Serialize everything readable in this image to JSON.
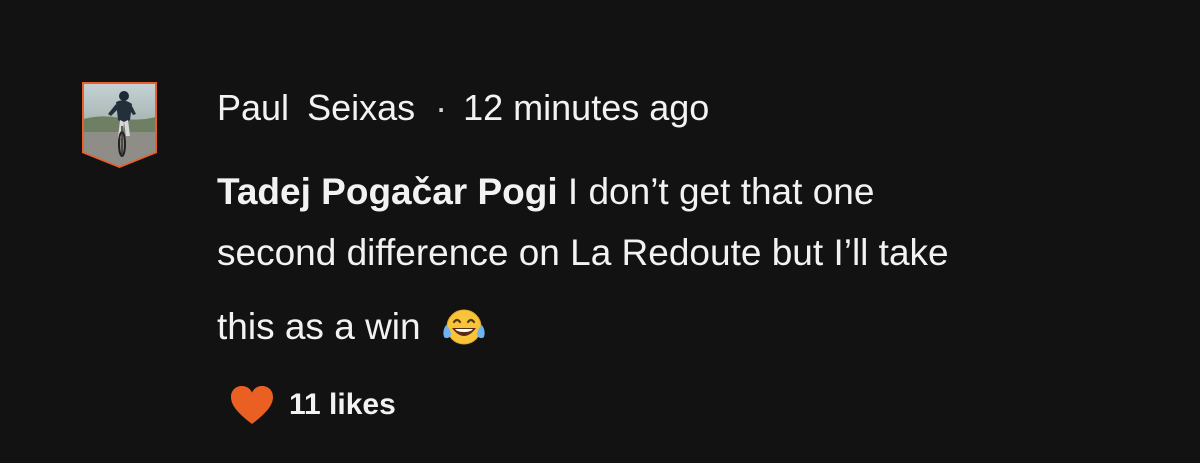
{
  "comment": {
    "author_first": "Paul",
    "author_last": "Seixas",
    "separator": "·",
    "timestamp": "12 minutes ago",
    "mention": "Tadej Pogačar Pogi",
    "text_line1": "I don’t get that one",
    "text_line2": "second difference on La Redoute but I’ll take",
    "text_line3": "this as a win",
    "emoji": "face-with-tears-of-joy-icon",
    "likes": "11 likes"
  },
  "colors": {
    "background": "#121212",
    "avatar_border": "#e8602c",
    "heart": "#ea5f22",
    "text": "#f2f2f2"
  }
}
